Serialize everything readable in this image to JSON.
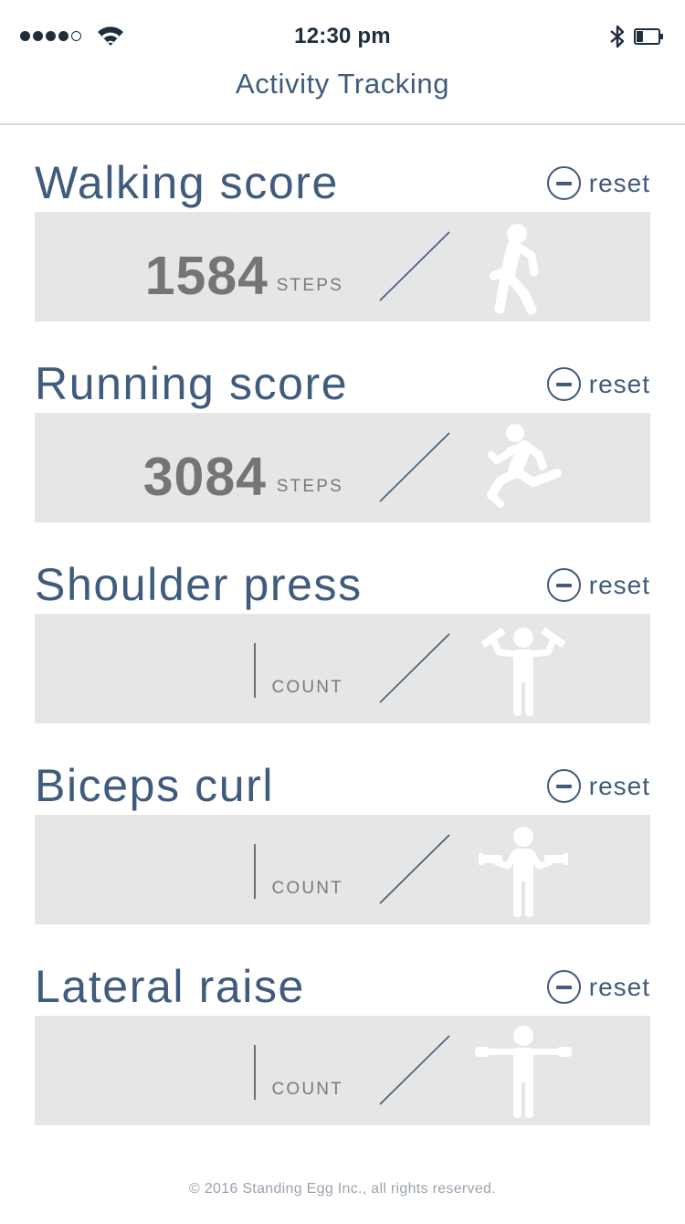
{
  "status_bar": {
    "time": "12:30 pm",
    "signal_bars_filled": 4,
    "signal_bars_total": 5,
    "battery_level": 0.3
  },
  "nav": {
    "title": "Activity Tracking"
  },
  "activities": [
    {
      "title": "Walking score",
      "reset_label": "reset",
      "value": "1584",
      "unit": "STEPS",
      "icon": "walking-person-icon"
    },
    {
      "title": "Running score",
      "reset_label": "reset",
      "value": "3084",
      "unit": "STEPS",
      "icon": "running-person-icon"
    },
    {
      "title": "Shoulder press",
      "reset_label": "reset",
      "value": "",
      "unit": "COUNT",
      "icon": "shoulder-press-icon"
    },
    {
      "title": "Biceps curl",
      "reset_label": "reset",
      "value": "",
      "unit": "COUNT",
      "icon": "biceps-curl-icon"
    },
    {
      "title": "Lateral raise",
      "reset_label": "reset",
      "value": "",
      "unit": "COUNT",
      "icon": "lateral-raise-icon"
    }
  ],
  "footer": {
    "copyright": "© 2016 Standing Egg Inc., all rights reserved."
  },
  "colors": {
    "accent": "#3f5b7d",
    "card_bg": "#e6e6e6",
    "value_text": "#757575",
    "figure": "#ffffff"
  }
}
